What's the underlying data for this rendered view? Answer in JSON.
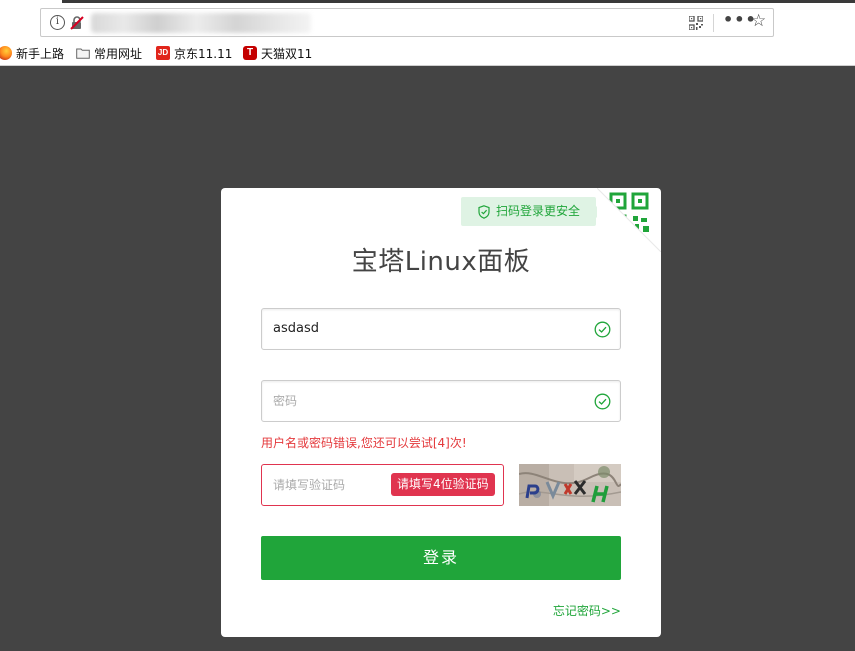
{
  "browser": {
    "bookmarks": [
      {
        "label": "新手上路",
        "icon": "firefox-icon"
      },
      {
        "label": "常用网址",
        "icon": "folder-icon"
      },
      {
        "label": "京东11.11",
        "icon": "jd-icon",
        "icon_text": "JD"
      },
      {
        "label": "天猫双11",
        "icon": "tmall-icon",
        "icon_text": "T"
      }
    ],
    "more_label": "•••",
    "star_label": "☆",
    "info_label": "i"
  },
  "login": {
    "qr_tip": "扫码登录更安全",
    "title": "宝塔Linux面板",
    "username_value": "asdasd",
    "password_placeholder": "密码",
    "error_message": "用户名或密码错误,您还可以尝试[4]次!",
    "code_placeholder": "请填写验证码",
    "code_tip": "请填写4位验证码",
    "login_label": "登录",
    "forgot_label": "忘记密码>>"
  },
  "colors": {
    "accent": "#20a53a",
    "error": "#e0344f",
    "page_bg": "#444444"
  }
}
